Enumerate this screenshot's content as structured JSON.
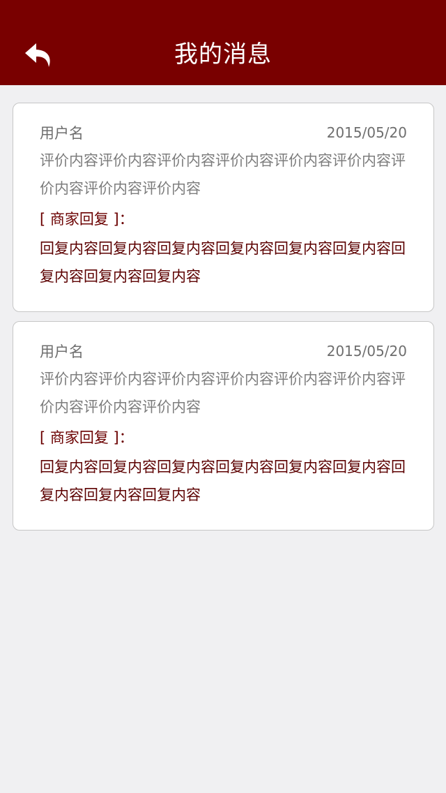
{
  "header": {
    "title": "我的消息",
    "back_icon": "back-arrow-icon"
  },
  "colors": {
    "header_bg": "#790000",
    "page_bg": "#f0f0f2",
    "reply_text": "#5c0000"
  },
  "messages": [
    {
      "username": "用户名",
      "date": "2015/05/20",
      "review": "评价内容评价内容评价内容评价内容评价内容评价内容评价内容评价内容评价内容",
      "reply_label": "[ 商家回复 ]：",
      "reply": "回复内容回复内容回复内容回复内容回复内容回复内容回复内容回复内容回复内容"
    },
    {
      "username": "用户名",
      "date": "2015/05/20",
      "review": "评价内容评价内容评价内容评价内容评价内容评价内容评价内容评价内容评价内容",
      "reply_label": "[ 商家回复 ]：",
      "reply": "回复内容回复内容回复内容回复内容回复内容回复内容回复内容回复内容回复内容"
    }
  ]
}
